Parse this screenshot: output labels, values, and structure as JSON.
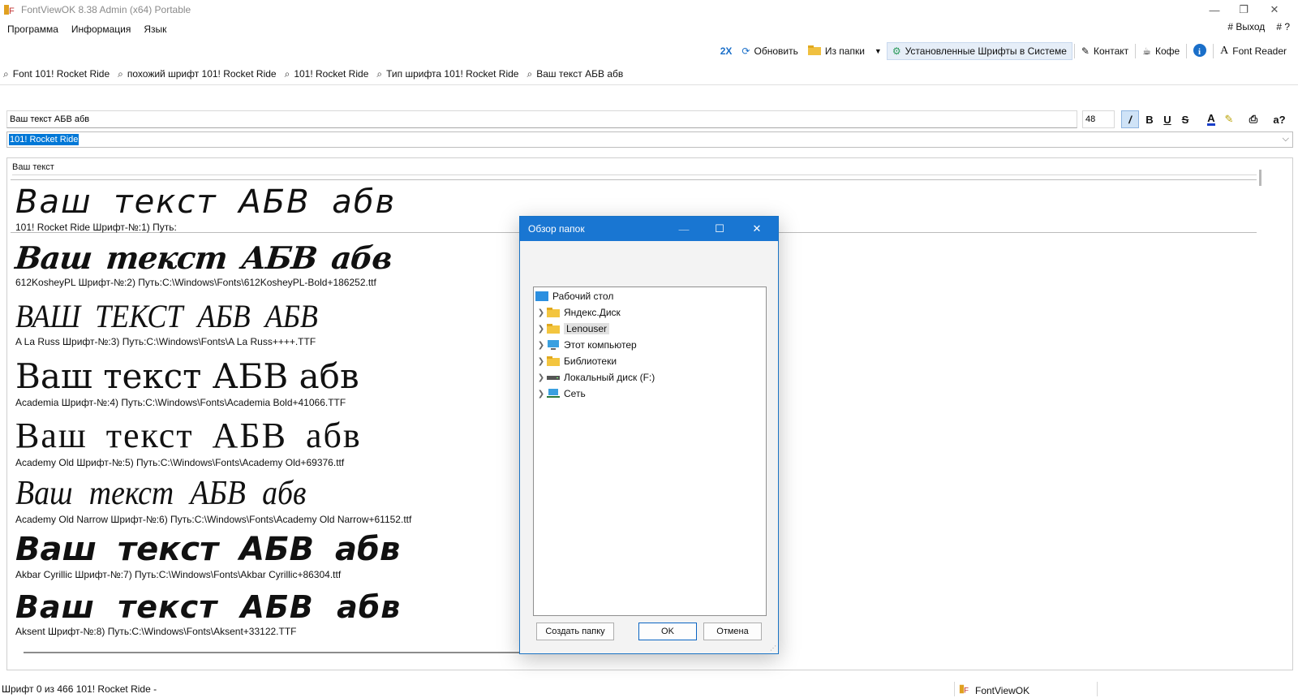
{
  "window": {
    "title": "FontViewOK 8.38 Admin (x64) Portable",
    "minimize": "—",
    "restore": "❐",
    "close": "✕"
  },
  "menu": {
    "items": [
      "Программа",
      "Информация",
      "Язык"
    ],
    "exit": "# Выход",
    "help": "# ?"
  },
  "toolbar": {
    "two_x": "2X",
    "refresh": "Обновить",
    "from_folder": "Из папки",
    "installed": "Установленные Шрифты в Системе",
    "contact": "Контакт",
    "coffee": "Кофе",
    "font_reader": "Font Reader"
  },
  "tabs": [
    {
      "label": "Font 101! Rocket Ride"
    },
    {
      "label": "похожий шрифт  101! Rocket Ride"
    },
    {
      "label": "101! Rocket Ride"
    },
    {
      "label": "Тип шрифта  101! Rocket Ride"
    },
    {
      "label": "Ваш текст АБВ абв"
    }
  ],
  "editor": {
    "text_value": "Ваш текст АБВ абв",
    "size_value": "48",
    "font_selected": "101! Rocket Ride",
    "case_button": "a?"
  },
  "preview": {
    "header": "Ваш текст",
    "rows": [
      {
        "sample": "Ваш текст АБВ абв",
        "caption": "101! Rocket Ride Шрифт-№:1) Путь:"
      },
      {
        "sample": "Ваш текст АБВ абв",
        "caption": "612KosheyPL Шрифт-№:2) Путь:C:\\Windows\\Fonts\\612KosheyPL-Bold+186252.ttf"
      },
      {
        "sample": "ВАШ ТЕКСТ АБВ АБВ",
        "caption": "A La Russ Шрифт-№:3) Путь:C:\\Windows\\Fonts\\A La Russ++++.TTF"
      },
      {
        "sample": "Ваш текст АБВ абв",
        "caption": "Academia Шрифт-№:4) Путь:C:\\Windows\\Fonts\\Academia Bold+41066.TTF"
      },
      {
        "sample": "Ваш текст АБВ абв",
        "caption": "Academy Old Шрифт-№:5) Путь:C:\\Windows\\Fonts\\Academy Old+69376.ttf"
      },
      {
        "sample": "Ваш текст АБВ абв",
        "caption": "Academy Old Narrow Шрифт-№:6) Путь:C:\\Windows\\Fonts\\Academy Old Narrow+61152.ttf"
      },
      {
        "sample": "Ваш текст АБВ абв",
        "caption": "Akbar Cyrillic Шрифт-№:7) Путь:C:\\Windows\\Fonts\\Akbar Cyrillic+86304.ttf"
      },
      {
        "sample": "Ваш текст АБВ абв",
        "caption": "Aksent Шрифт-№:8) Путь:C:\\Windows\\Fonts\\Aksent+33122.TTF"
      }
    ]
  },
  "dialog": {
    "title": "Обзор папок",
    "tree": [
      {
        "label": "Рабочий стол"
      },
      {
        "label": "Яндекс.Диск"
      },
      {
        "label": "Lenouser"
      },
      {
        "label": "Этот компьютер"
      },
      {
        "label": "Библиотеки"
      },
      {
        "label": "Локальный диск (F:)"
      },
      {
        "label": "Сеть"
      }
    ],
    "new_folder": "Создать папку",
    "ok": "OK",
    "cancel": "Отмена"
  },
  "status": {
    "left": "Шрифт 0 из 466 101! Rocket Ride -",
    "app": "FontViewOK"
  },
  "colors": {
    "accent": "#1976d2",
    "selection": "#0078d7"
  }
}
